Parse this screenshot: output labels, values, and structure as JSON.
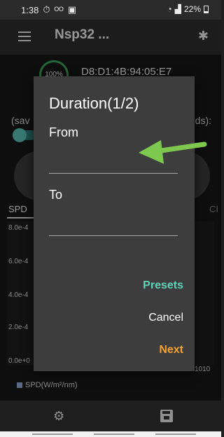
{
  "status_bar": {
    "time": "1:38",
    "notif_icons": [
      "stopwatch-icon",
      "voicemail-icon",
      "gallery-icon"
    ],
    "battery_percent": "22%"
  },
  "app_bar": {
    "title": "Nsp32 ...",
    "menu_icon": "hamburger-menu-icon",
    "bluetooth_icon": "bluetooth-icon"
  },
  "device": {
    "battery_level": "100%",
    "mac_address": "D8:D1:4B:94:05:E7"
  },
  "background": {
    "save_prefix": "(sav",
    "save_suffix": "ds):",
    "tab_spd": "SPD",
    "tab_right": "CI",
    "y_ticks": [
      "8.0e-4",
      "6.0e-4",
      "4.0e-4",
      "2.0e-4",
      "0.0e+0"
    ],
    "x_tick_last": "1010",
    "legend_label": "SPD(W/m²/nm)"
  },
  "dialog": {
    "title": "Duration(1/2)",
    "from_label": "From",
    "from_value": "",
    "to_label": "To",
    "to_value": "",
    "presets_label": "Presets",
    "cancel_label": "Cancel",
    "next_label": "Next"
  },
  "colors": {
    "accent_presets": "#5fd3b7",
    "accent_next": "#f5a12c",
    "annotation_arrow": "#7ec850"
  }
}
